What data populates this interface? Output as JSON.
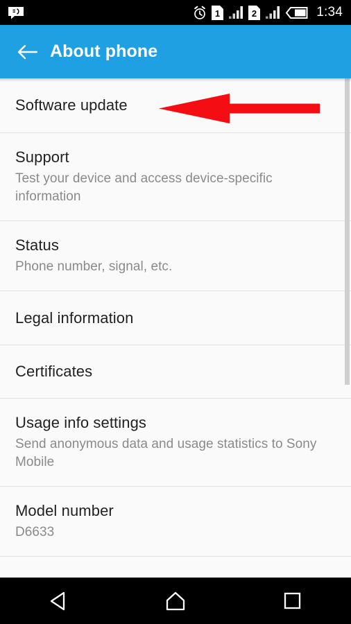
{
  "status_bar": {
    "notification_icon": "sms-message-icon",
    "alarm_icon": "alarm-clock-icon",
    "sim1_label": "1",
    "sim2_label": "2",
    "sim1_icon": "sim-card-1-icon",
    "sim2_icon": "sim-card-2-icon",
    "signal1_icon": "signal-bars-icon",
    "signal2_icon": "signal-bars-icon",
    "battery_icon": "battery-icon",
    "time": "1:34"
  },
  "app_bar": {
    "back_icon": "arrow-left-icon",
    "title": "About phone",
    "background_color": "#1fa0e3",
    "text_color": "#ffffff"
  },
  "annotation": {
    "arrow_icon": "red-arrow-left-annotation",
    "color": "#f40d12",
    "points_at": "Software update"
  },
  "list": {
    "items": [
      {
        "title": "Software update",
        "subtitle": ""
      },
      {
        "title": "Support",
        "subtitle": "Test your device and access device-specific information"
      },
      {
        "title": "Status",
        "subtitle": "Phone number, signal, etc."
      },
      {
        "title": "Legal information",
        "subtitle": ""
      },
      {
        "title": "Certificates",
        "subtitle": ""
      },
      {
        "title": "Usage info settings",
        "subtitle": "Send anonymous data and usage statistics to Sony Mobile"
      },
      {
        "title": "Model number",
        "subtitle": "D6633"
      }
    ]
  },
  "scrollbar": {
    "name": "vertical-scrollbar"
  },
  "nav_bar": {
    "back_icon": "nav-back-triangle-icon",
    "home_icon": "nav-home-icon",
    "recents_icon": "nav-recents-square-icon"
  }
}
